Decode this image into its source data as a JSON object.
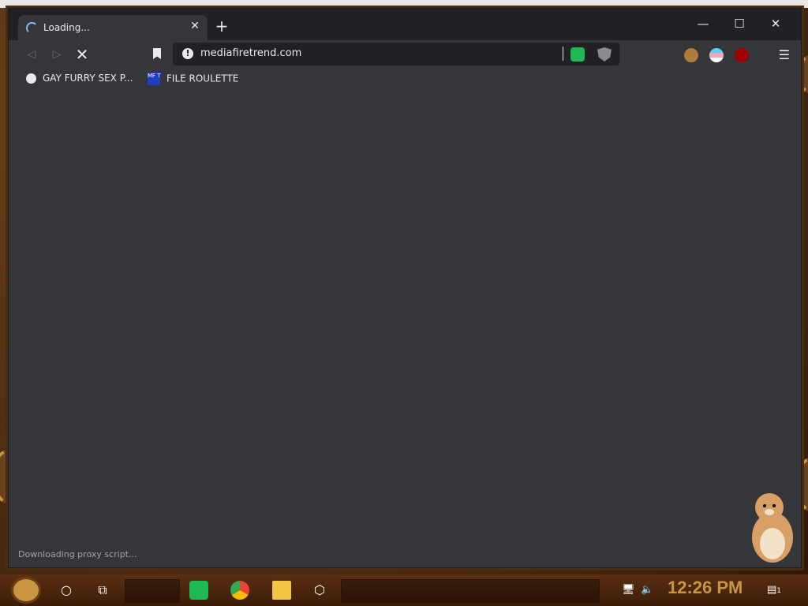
{
  "browser": {
    "tab": {
      "title": "Loading..."
    },
    "new_tab_label": "+",
    "window_controls": {
      "minimize": "—",
      "maximize": "☐",
      "close": "✕"
    },
    "toolbar": {
      "back": "◁",
      "forward": "▷",
      "stop": "✕",
      "url": "mediafiretrend.com",
      "info": "!"
    },
    "bookmarks": [
      {
        "label": "GAY FURRY SEX P...",
        "icon": "globe-icon"
      },
      {
        "label": "FILE ROULETTE",
        "icon": "mft-icon",
        "icon_text": "MF T"
      }
    ],
    "status": "Downloading proxy script...",
    "menu": "☰"
  },
  "taskbar": {
    "clock": "12:26 PM",
    "notifications_count": "1"
  },
  "colors": {
    "frame": "#202124",
    "toolbar": "#35363a",
    "accent_blue": "#8ab4f8",
    "clock": "#c9953f"
  }
}
